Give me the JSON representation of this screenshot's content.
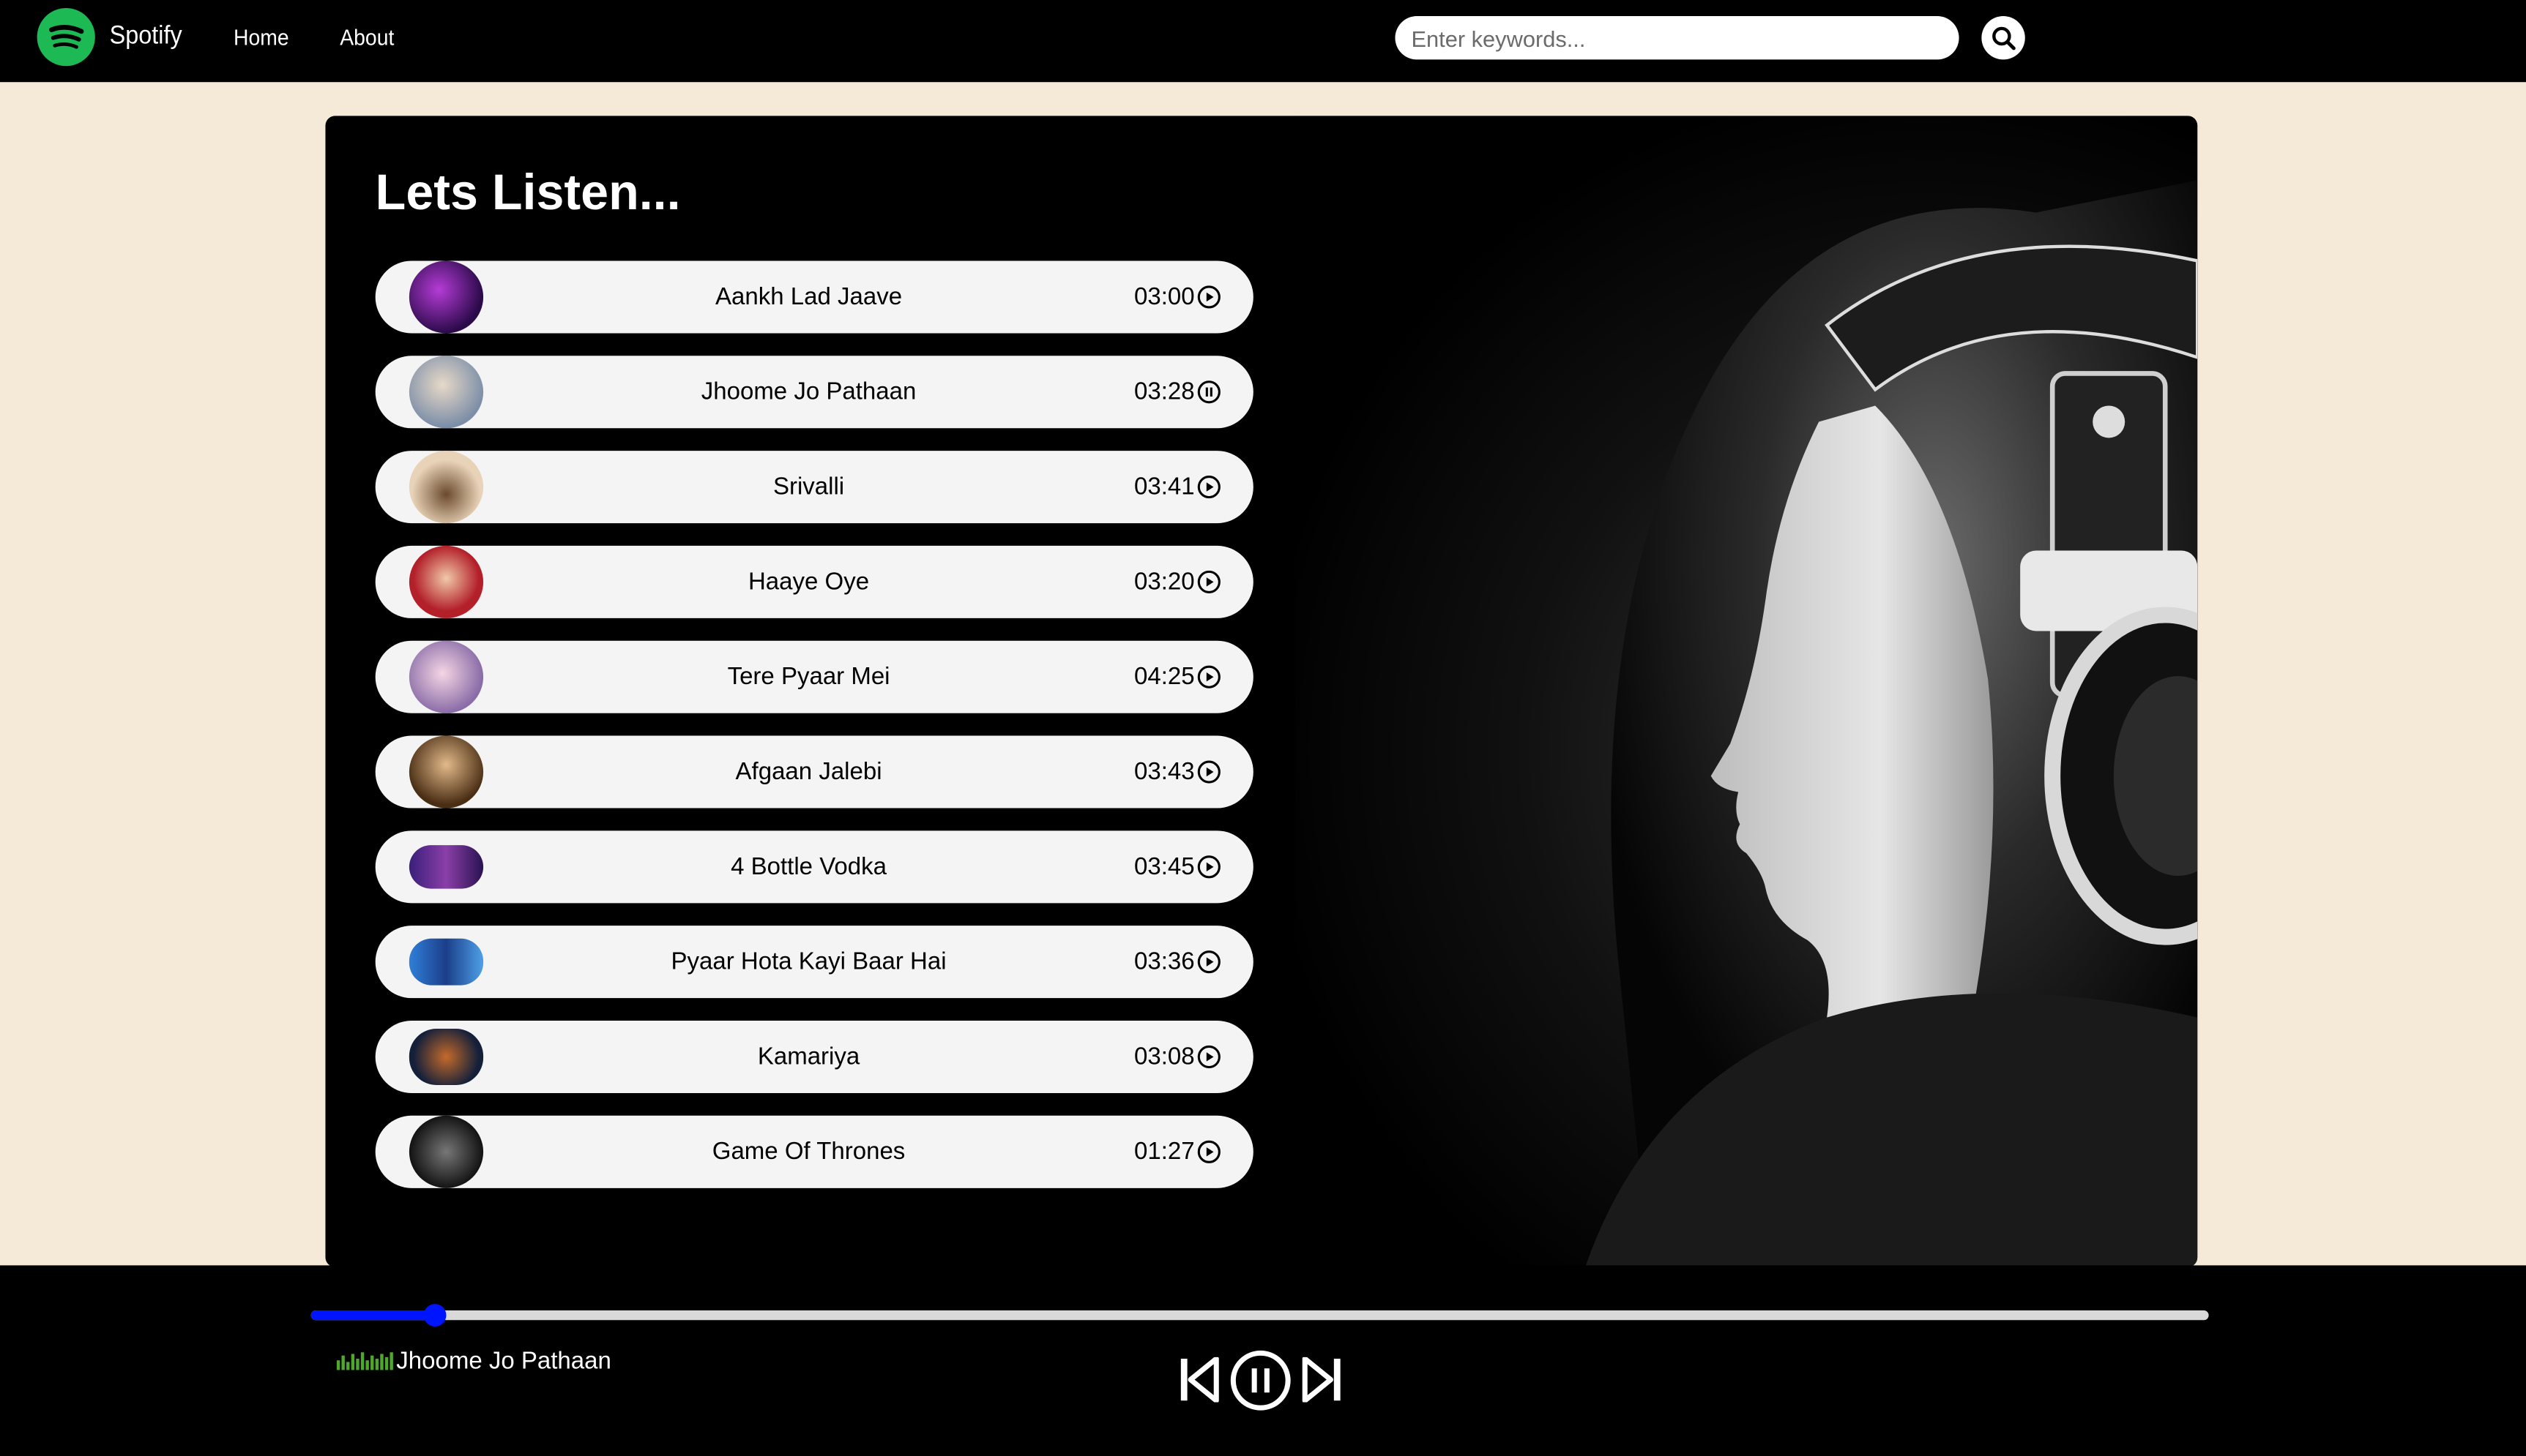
{
  "nav": {
    "brand": "Spotify",
    "links": [
      "Home",
      "About"
    ],
    "search_placeholder": "Enter keywords..."
  },
  "main": {
    "title": "Lets Listen...",
    "songs": [
      {
        "name": "Aankh Lad Jaave",
        "duration": "03:00",
        "state": "play"
      },
      {
        "name": "Jhoome Jo Pathaan",
        "duration": "03:28",
        "state": "pause"
      },
      {
        "name": "Srivalli",
        "duration": "03:41",
        "state": "play"
      },
      {
        "name": "Haaye Oye",
        "duration": "03:20",
        "state": "play"
      },
      {
        "name": "Tere Pyaar Mei",
        "duration": "04:25",
        "state": "play"
      },
      {
        "name": "Afgaan Jalebi",
        "duration": "03:43",
        "state": "play"
      },
      {
        "name": "4 Bottle Vodka",
        "duration": "03:45",
        "state": "play"
      },
      {
        "name": "Pyaar Hota Kayi Baar Hai",
        "duration": "03:36",
        "state": "play"
      },
      {
        "name": "Kamariya",
        "duration": "03:08",
        "state": "play"
      },
      {
        "name": "Game Of Thrones",
        "duration": "01:27",
        "state": "play"
      }
    ]
  },
  "player": {
    "now_playing": "Jhoome Jo Pathaan",
    "progress": 0.065,
    "state": "playing"
  },
  "colors": {
    "brand_green": "#1db954",
    "progress": "#0015ff",
    "eq": "#4ea82a",
    "page_bg": "#f5ead8"
  }
}
